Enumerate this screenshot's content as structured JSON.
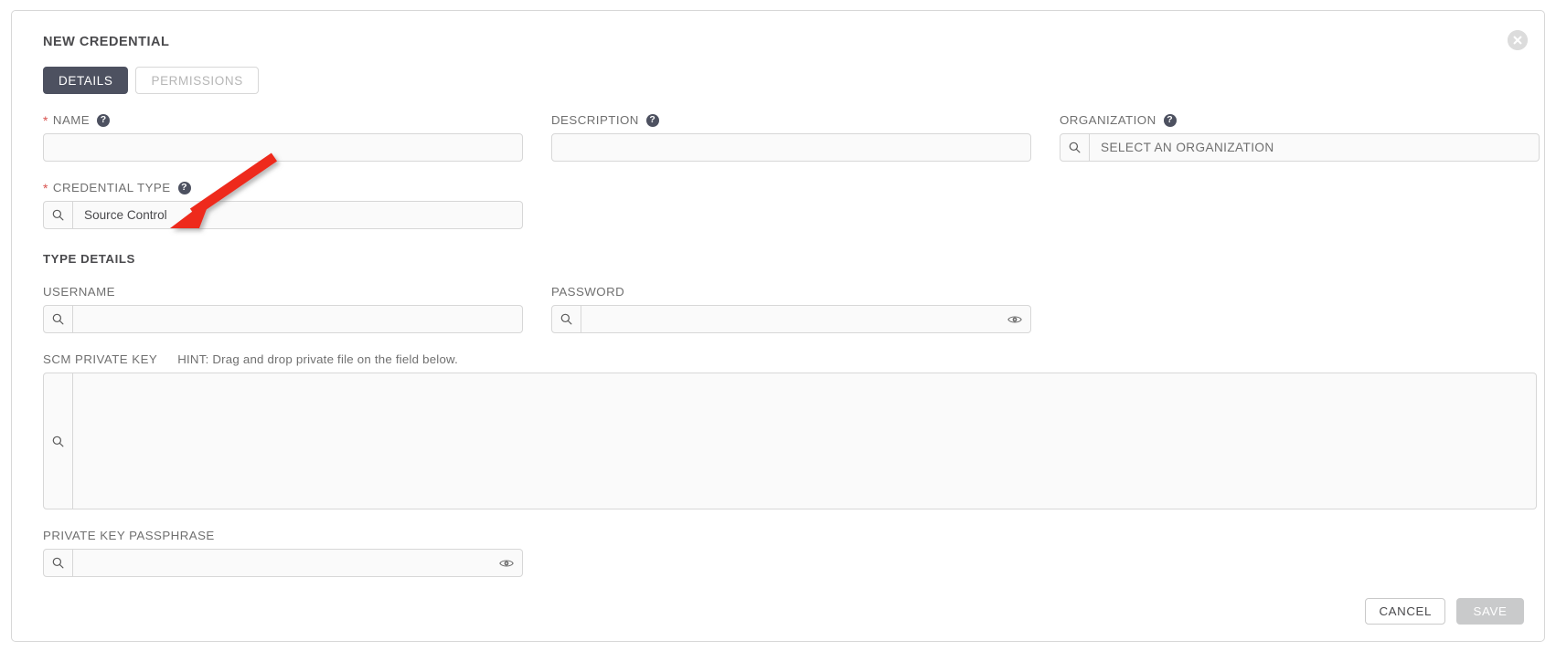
{
  "panel": {
    "title": "NEW CREDENTIAL",
    "close_icon": "close-circle-icon"
  },
  "tabs": [
    {
      "label": "DETAILS",
      "active": true
    },
    {
      "label": "PERMISSIONS",
      "active": false
    }
  ],
  "fields": {
    "name": {
      "label": "NAME",
      "required": true,
      "help": "?",
      "value": "",
      "placeholder": ""
    },
    "description": {
      "label": "DESCRIPTION",
      "required": false,
      "help": "?",
      "value": "",
      "placeholder": ""
    },
    "organization": {
      "label": "ORGANIZATION",
      "required": false,
      "help": "?",
      "value": "",
      "placeholder": "SELECT AN ORGANIZATION",
      "lookup_icon": "search-icon"
    },
    "credential_type": {
      "label": "CREDENTIAL TYPE",
      "required": true,
      "help": "?",
      "value": "Source Control",
      "placeholder": "",
      "lookup_icon": "search-icon"
    },
    "username": {
      "label": "USERNAME",
      "value": "",
      "placeholder": "",
      "lookup_icon": "search-icon"
    },
    "password": {
      "label": "PASSWORD",
      "value": "",
      "placeholder": "",
      "lookup_icon": "search-icon",
      "reveal_icon": "eye-icon"
    },
    "scm_private_key": {
      "label": "SCM PRIVATE KEY",
      "hint": "HINT: Drag and drop private file on the field below.",
      "value": "",
      "lookup_icon": "search-icon"
    },
    "private_key_passphrase": {
      "label": "PRIVATE KEY PASSPHRASE",
      "value": "",
      "placeholder": "",
      "lookup_icon": "search-icon",
      "reveal_icon": "eye-icon"
    }
  },
  "sections": {
    "type_details": "TYPE DETAILS"
  },
  "footer": {
    "cancel_label": "CANCEL",
    "save_label": "SAVE",
    "save_disabled": true
  },
  "annotation": {
    "arrow_color": "#ee2a1e",
    "points_to": "credential-type-input"
  }
}
